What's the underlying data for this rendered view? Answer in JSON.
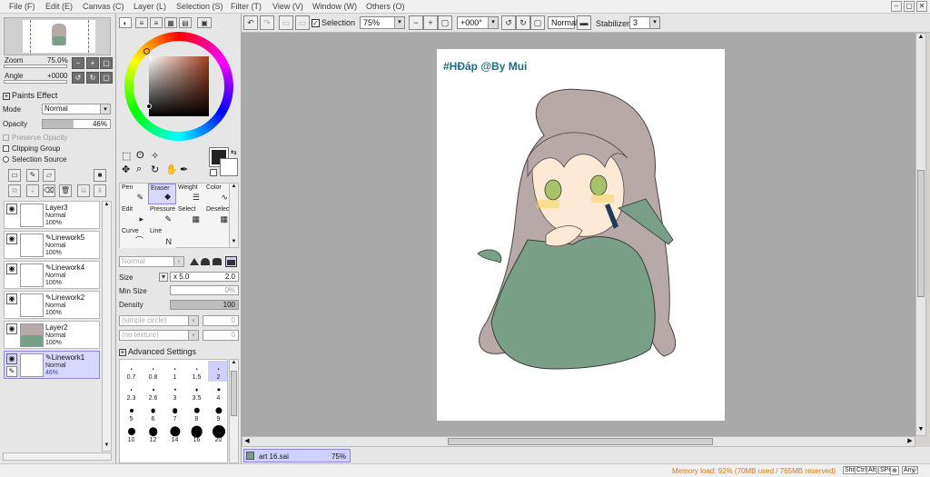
{
  "menu": [
    "File (F)",
    "Edit (E)",
    "Canvas (C)",
    "Layer (L)",
    "Selection (S)",
    "Filter (T)",
    "View (V)",
    "Window (W)",
    "Others (O)"
  ],
  "window_controls": [
    "–",
    "▢",
    "✕"
  ],
  "navigator": {
    "zoom_label": "Zoom",
    "zoom_value": "75.0%",
    "angle_label": "Angle",
    "angle_value": "+0000"
  },
  "paints_effect": {
    "header": "Paints Effect",
    "mode_label": "Mode",
    "mode_value": "Normal",
    "opacity_label": "Opacity",
    "opacity_value": "46%",
    "opacity_fraction": 0.46
  },
  "checks": {
    "preserve_opacity": "Preserve Opacity",
    "clipping_group": "Clipping Group",
    "selection_source": "Selection Source"
  },
  "layers": [
    {
      "name": "Layer3",
      "mode": "Normal",
      "opacity": "100%",
      "linework": false
    },
    {
      "name": "Linework5",
      "mode": "Normal",
      "opacity": "100%",
      "linework": true
    },
    {
      "name": "Linework4",
      "mode": "Normal",
      "opacity": "100%",
      "linework": true
    },
    {
      "name": "Linework2",
      "mode": "Normal",
      "opacity": "100%",
      "linework": true
    },
    {
      "name": "Layer2",
      "mode": "Normal",
      "opacity": "100%",
      "linework": false
    },
    {
      "name": "Linework1",
      "mode": "Normal",
      "opacity": "46%",
      "linework": true,
      "selected": true
    }
  ],
  "tools": [
    {
      "label": "Pen",
      "icon": "✎"
    },
    {
      "label": "Eraser",
      "icon": "◆",
      "selected": true
    },
    {
      "label": "Weight",
      "icon": "☰"
    },
    {
      "label": "Color",
      "icon": "∿"
    },
    {
      "label": "Edit",
      "icon": "▸"
    },
    {
      "label": "Pressure",
      "icon": "✎"
    },
    {
      "label": "Select",
      "icon": "▦"
    },
    {
      "label": "Deselect",
      "icon": "▦"
    },
    {
      "label": "Curve",
      "icon": "⌒"
    },
    {
      "label": "Line",
      "icon": "N"
    }
  ],
  "tool_settings": {
    "blend_mode": "Normal",
    "size_label": "Size",
    "size_mult": "x 5.0",
    "size_value": "2.0",
    "minsize_label": "Min Size",
    "minsize_value": "0%",
    "density_label": "Density",
    "density_value": "100",
    "shape": "(simple circle)",
    "texture": "(no texture)",
    "shape_val": "0",
    "texture_val": "0",
    "advanced": "Advanced Settings"
  },
  "brush_sizes": [
    "0.7",
    "0.8",
    "1",
    "1.5",
    "2",
    "2.3",
    "2.6",
    "3",
    "3.5",
    "4",
    "5",
    "6",
    "7",
    "8",
    "9",
    "10",
    "12",
    "14",
    "16",
    "20"
  ],
  "brush_selected": "2",
  "toolbar": {
    "selection_label": "Selection",
    "zoom": "75%",
    "angle": "+000°",
    "blend": "Normal",
    "stabilizer_label": "Stabilizer",
    "stabilizer_value": "3"
  },
  "canvas": {
    "watermark": "#HĐáp @By Mui"
  },
  "tab": {
    "name": "art 16.sai",
    "zoom": "75%"
  },
  "status": {
    "memory": "Memory load: 92% (70MB used / 765MB reserved)",
    "keys": [
      "Shift",
      "Ctrl",
      "Alt",
      "SPC",
      "⊕",
      "Any",
      "∕"
    ]
  },
  "colors": {
    "accent": "#d8d8ff",
    "canvas_bg": "#a9a9a9",
    "paper": "#ffffff",
    "sweater": "#7a9f88",
    "hair": "#b7a9a8",
    "memory_text": "#d27a1a"
  }
}
